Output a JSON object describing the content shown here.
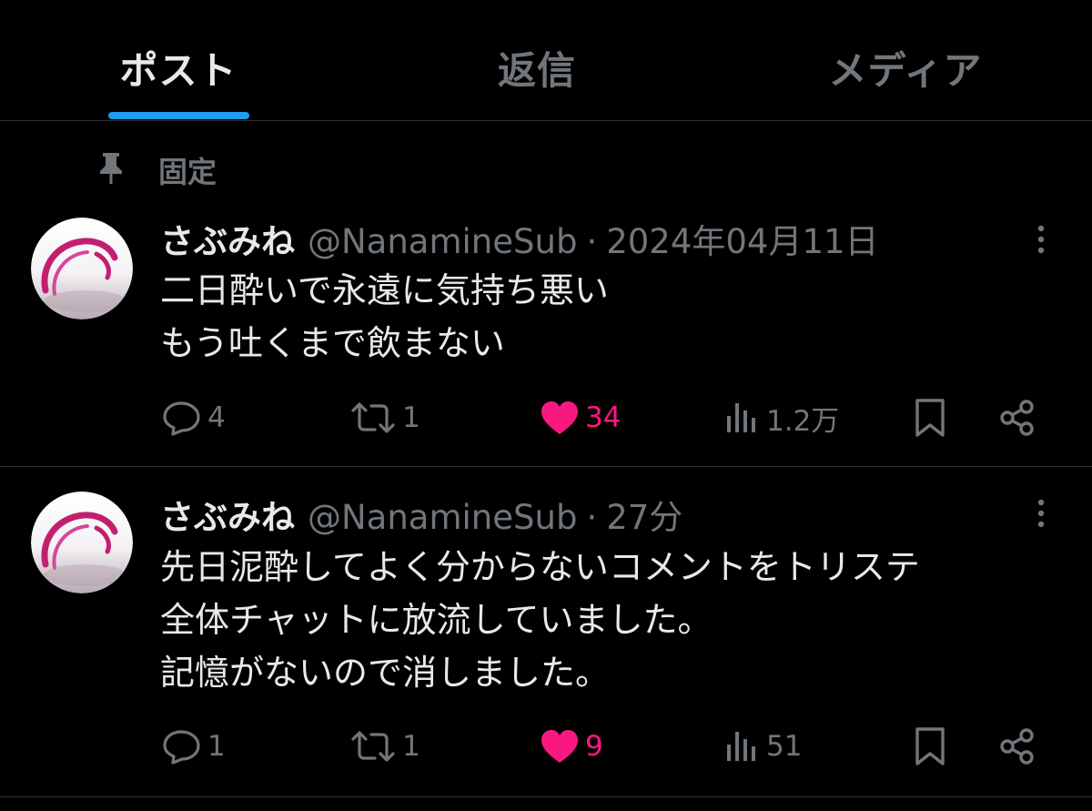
{
  "tabs": [
    {
      "label": "ポスト",
      "active": true
    },
    {
      "label": "返信",
      "active": false
    },
    {
      "label": "メディア",
      "active": false
    }
  ],
  "pinned_label": "固定",
  "posts": [
    {
      "display_name": "さぶみね",
      "handle": "@NanamineSub",
      "separator": "·",
      "time": "2024年04月11日",
      "text": "二日酔いで永遠に気持ち悪い\nもう吐くまで飲まない",
      "replies": "4",
      "reposts": "1",
      "likes": "34",
      "views": "1.2万"
    },
    {
      "display_name": "さぶみね",
      "handle": "@NanamineSub",
      "separator": "·",
      "time": "27分",
      "text": "先日泥酔してよく分からないコメントをトリステ\n全体チャットに放流していました。\n記憶がないので消しました。",
      "replies": "1",
      "reposts": "1",
      "likes": "9",
      "views": "51"
    }
  ],
  "icons": {
    "pin": "pin-icon",
    "reply": "reply-icon",
    "repost": "repost-icon",
    "like": "heart-icon",
    "views": "views-icon",
    "bookmark": "bookmark-icon",
    "share": "share-icon",
    "more": "more-icon"
  },
  "colors": {
    "background": "#000000",
    "accent": "#1d9bf0",
    "like": "#f91880",
    "muted": "#71767b",
    "text": "#e7e9ea"
  }
}
